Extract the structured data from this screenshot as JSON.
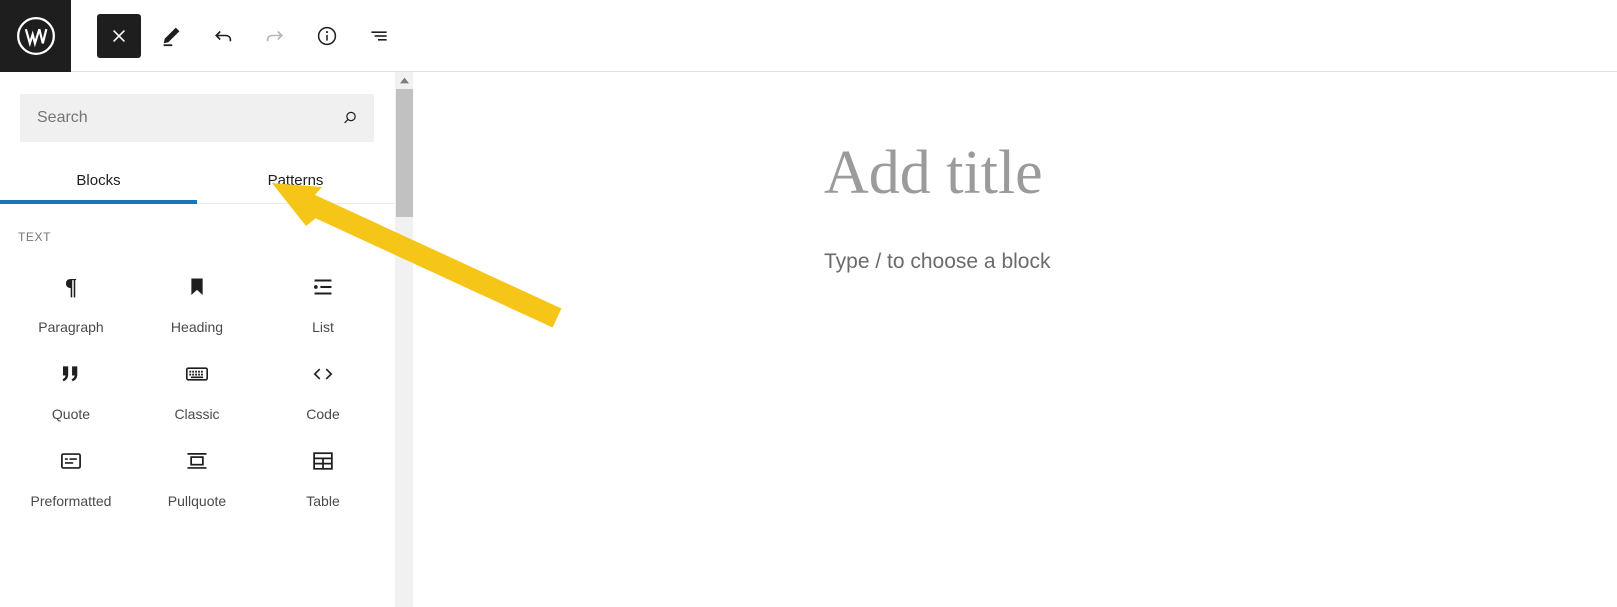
{
  "header": {
    "logo": {
      "name": "wordpress-logo",
      "label": "W"
    },
    "buttons": [
      {
        "name": "close-inserter-button",
        "icon": "close-icon",
        "label": "Close block inserter",
        "state": "active"
      },
      {
        "name": "edit-mode-button",
        "icon": "pencil-icon",
        "label": "Edit",
        "state": "default"
      },
      {
        "name": "undo-button",
        "icon": "undo-icon",
        "label": "Undo",
        "state": "default"
      },
      {
        "name": "redo-button",
        "icon": "redo-icon",
        "label": "Redo",
        "state": "disabled"
      },
      {
        "name": "details-button",
        "icon": "info-icon",
        "label": "Details",
        "state": "default"
      },
      {
        "name": "list-view-button",
        "icon": "list-view-icon",
        "label": "List View",
        "state": "default"
      }
    ]
  },
  "inserter": {
    "search": {
      "placeholder": "Search",
      "value": "",
      "icon": "search-icon"
    },
    "tabs": [
      {
        "label": "Blocks",
        "active": true
      },
      {
        "label": "Patterns",
        "active": false
      }
    ],
    "active_tab_color": "#1c75b9",
    "category": "TEXT",
    "blocks": [
      {
        "label": "Paragraph",
        "icon": "paragraph-icon"
      },
      {
        "label": "Heading",
        "icon": "heading-icon"
      },
      {
        "label": "List",
        "icon": "list-icon"
      },
      {
        "label": "Quote",
        "icon": "quote-icon"
      },
      {
        "label": "Classic",
        "icon": "classic-icon"
      },
      {
        "label": "Code",
        "icon": "code-icon"
      },
      {
        "label": "Preformatted",
        "icon": "preformatted-icon"
      },
      {
        "label": "Pullquote",
        "icon": "pullquote-icon"
      },
      {
        "label": "Table",
        "icon": "table-icon"
      }
    ]
  },
  "scrollbar": {
    "up_arrow_icon": "scroll-up-arrow-icon",
    "thumb": "scrollbar-thumb"
  },
  "editor": {
    "title_placeholder": "Add title",
    "block_placeholder": "Type / to choose a block"
  },
  "annotation": {
    "arrow_color": "#f5c518",
    "points_to": "Patterns"
  }
}
